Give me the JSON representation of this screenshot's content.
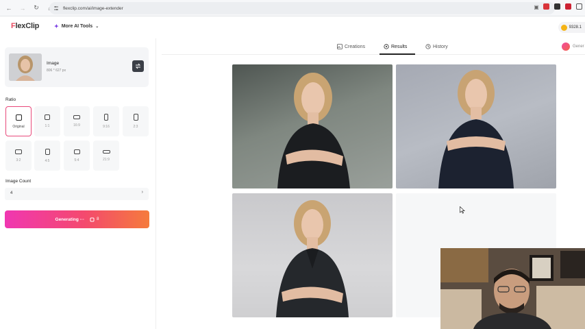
{
  "browser": {
    "url": "flexclip.com/ai/image-extender"
  },
  "header": {
    "logo_text_accent": "F",
    "logo_text_rest": "lexClip",
    "ai_tools_label": "More AI Tools",
    "credits": "9328.1"
  },
  "left_panel": {
    "image_card": {
      "title": "Image",
      "size": "806 * 627 px"
    },
    "ratio_label": "Ratio",
    "ratios": [
      {
        "label": "Original",
        "selected": true
      },
      {
        "label": "1:1",
        "selected": false
      },
      {
        "label": "16:9",
        "selected": false
      },
      {
        "label": "9:16",
        "selected": false
      },
      {
        "label": "2:3",
        "selected": false
      },
      {
        "label": "3:2",
        "selected": false
      },
      {
        "label": "4:5",
        "selected": false
      },
      {
        "label": "5:4",
        "selected": false
      },
      {
        "label": "21:9",
        "selected": false
      }
    ],
    "image_count_label": "Image Count",
    "image_count_value": "4",
    "generate_button": {
      "label": "Generating ···",
      "cost": "8"
    }
  },
  "results": {
    "tabs": [
      {
        "label": "Creations",
        "icon": "image-icon",
        "active": false
      },
      {
        "label": "Results",
        "icon": "results-icon",
        "active": true
      },
      {
        "label": "History",
        "icon": "history-icon",
        "active": false
      }
    ],
    "status_chip": "Gener"
  },
  "colors": {
    "accent_pink": "#e8487a",
    "gradient_start": "#f037b1",
    "gradient_end": "#f57b3c"
  }
}
